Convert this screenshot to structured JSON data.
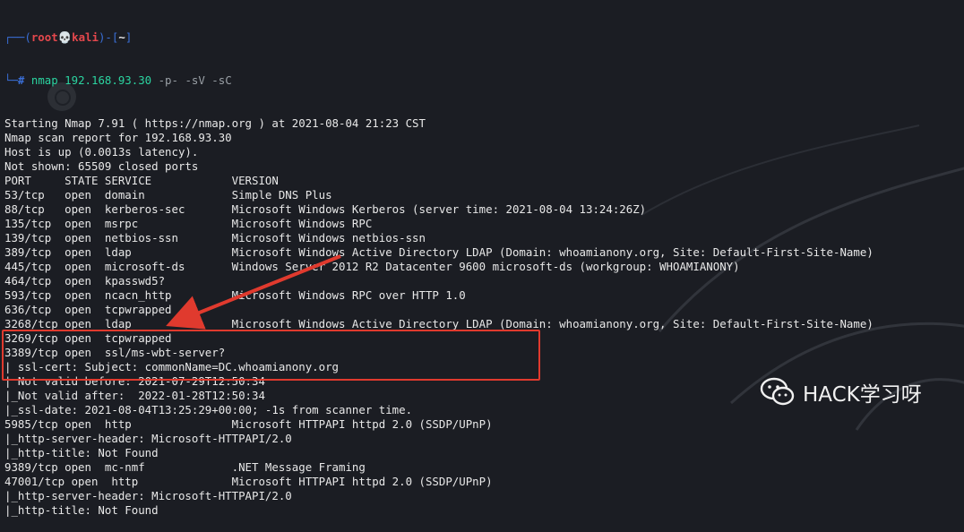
{
  "terminal": {
    "prompt": {
      "top_prefix": "┌──(",
      "user_host": "root💀kali",
      "sep_open": ")-[",
      "path": "~",
      "sep_close": "]",
      "bottom_prefix": "└─",
      "hash": "#",
      "command": "nmap 192.168.93.30",
      "flags": " -p- -sV -sC"
    },
    "lines": [
      "Starting Nmap 7.91 ( https://nmap.org ) at 2021-08-04 21:23 CST",
      "Nmap scan report for 192.168.93.30",
      "Host is up (0.0013s latency).",
      "Not shown: 65509 closed ports",
      "PORT     STATE SERVICE            VERSION",
      "53/tcp   open  domain             Simple DNS Plus",
      "88/tcp   open  kerberos-sec       Microsoft Windows Kerberos (server time: 2021-08-04 13:24:26Z)",
      "135/tcp  open  msrpc              Microsoft Windows RPC",
      "139/tcp  open  netbios-ssn        Microsoft Windows netbios-ssn",
      "389/tcp  open  ldap               Microsoft Windows Active Directory LDAP (Domain: whoamianony.org, Site: Default-First-Site-Name)",
      "445/tcp  open  microsoft-ds       Windows Server 2012 R2 Datacenter 9600 microsoft-ds (workgroup: WHOAMIANONY)",
      "464/tcp  open  kpasswd5?",
      "593/tcp  open  ncacn_http         Microsoft Windows RPC over HTTP 1.0",
      "636/tcp  open  tcpwrapped",
      "3268/tcp open  ldap               Microsoft Windows Active Directory LDAP (Domain: whoamianony.org, Site: Default-First-Site-Name)",
      "3269/tcp open  tcpwrapped",
      "3389/tcp open  ssl/ms-wbt-server?",
      "| ssl-cert: Subject: commonName=DC.whoamianony.org",
      "| Not valid before: 2021-07-29T12:50:34",
      "|_Not valid after:  2022-01-28T12:50:34",
      "|_ssl-date: 2021-08-04T13:25:29+00:00; -1s from scanner time.",
      "5985/tcp open  http               Microsoft HTTPAPI httpd 2.0 (SSDP/UPnP)",
      "|_http-server-header: Microsoft-HTTPAPI/2.0",
      "|_http-title: Not Found",
      "9389/tcp open  mc-nmf             .NET Message Framing",
      "47001/tcp open  http              Microsoft HTTPAPI httpd 2.0 (SSDP/UPnP)",
      "|_http-server-header: Microsoft-HTTPAPI/2.0",
      "|_http-title: Not Found"
    ]
  },
  "watermark": {
    "text": "HACK学习呀",
    "icon": "wechat-icon"
  },
  "colors": {
    "background": "#1b1d23",
    "prompt_blue": "#3a6fd8",
    "prompt_red": "#e5484d",
    "command_green": "#2bd4a0",
    "highlight_red": "#e03a2e"
  }
}
